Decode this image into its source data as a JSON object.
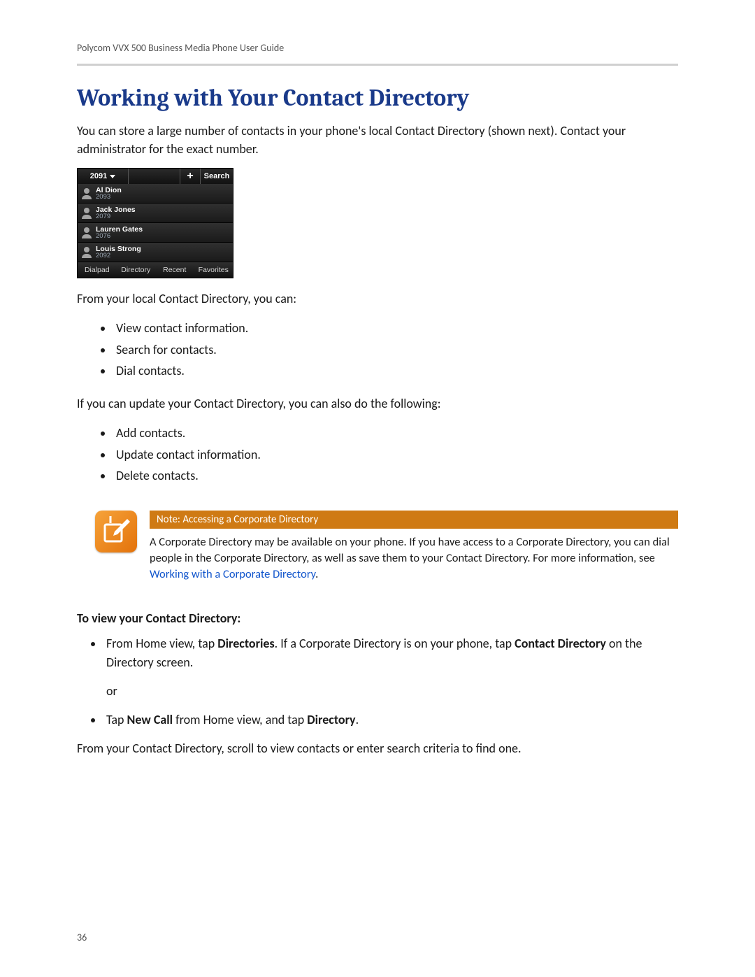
{
  "doc_header": "Polycom VVX 500 Business Media Phone User Guide",
  "section_title": "Working with Your Contact Directory",
  "intro_para": "You can store a large number of contacts in your phone's local Contact Directory (shown next). Contact your administrator for the exact number.",
  "phone_screenshot": {
    "extension": "2091",
    "add_label": "+",
    "search_label": "Search",
    "contacts": [
      {
        "name": "Al Dion",
        "ext": "2093"
      },
      {
        "name": "Jack Jones",
        "ext": "2079"
      },
      {
        "name": "Lauren Gates",
        "ext": "2076"
      },
      {
        "name": "Louis Strong",
        "ext": "2092"
      }
    ],
    "tabs": [
      "Dialpad",
      "Directory",
      "Recent",
      "Favorites"
    ]
  },
  "para_from_local": "From your local Contact Directory, you can:",
  "list_local": [
    "View contact information.",
    "Search for contacts.",
    "Dial contacts."
  ],
  "para_if_update": "If you can update your Contact Directory, you can also do the following:",
  "list_update": [
    "Add contacts.",
    "Update contact information.",
    "Delete contacts."
  ],
  "note": {
    "title": "Note: Accessing a Corporate Directory",
    "text_before_link": "A Corporate Directory may be available on your phone. If you have access to a Corporate Directory, you can dial people in the Corporate Directory, as well as save them to your Contact Directory. For more information, see ",
    "link_text": "Working with a Corporate Directory",
    "text_after_link": "."
  },
  "subheading": "To view your Contact Directory:",
  "step1": {
    "pre": "From Home view, tap ",
    "b1": "Directories",
    "mid": ". If a Corporate Directory is on your phone, tap ",
    "b2": "Contact Directory",
    "post": " on the Directory screen."
  },
  "or_text": "or",
  "step2": {
    "pre": "Tap ",
    "b1": "New Call",
    "mid": " from Home view, and tap ",
    "b2": "Directory",
    "post": "."
  },
  "closing_para": "From your Contact Directory, scroll to view contacts or enter search criteria to find one.",
  "page_number": "36"
}
